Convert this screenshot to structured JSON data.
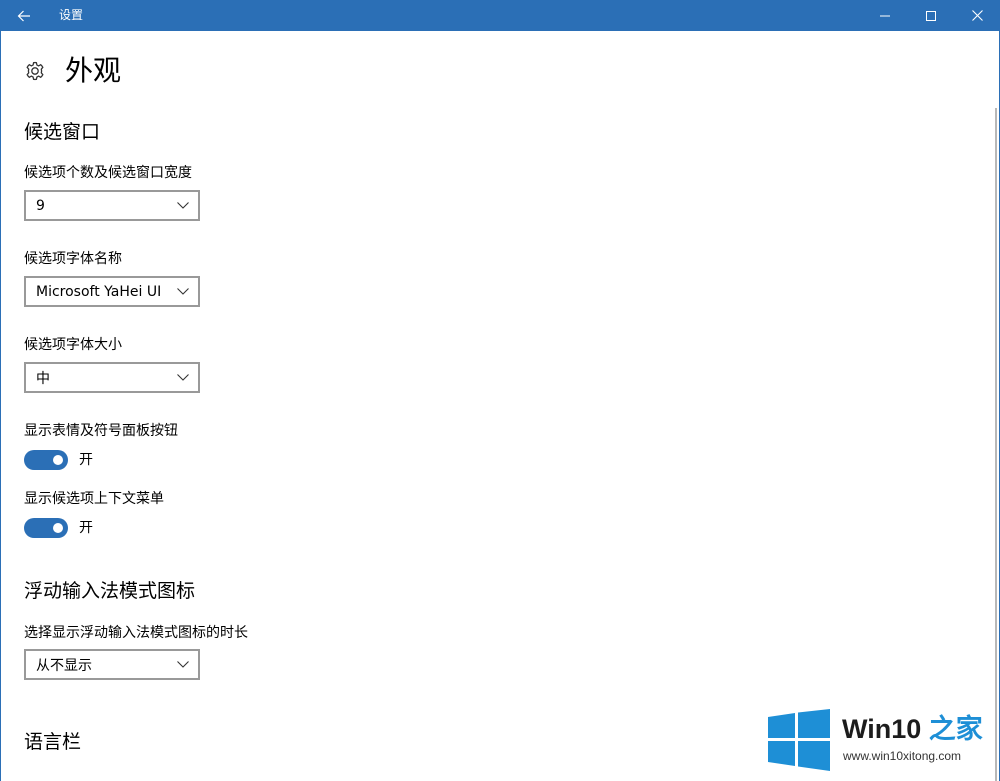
{
  "window": {
    "title": "设置",
    "back_icon": "back-arrow-icon",
    "titlebar_color": "#2b6fb6"
  },
  "page": {
    "title": "外观",
    "icon": "gear-icon"
  },
  "candidate_window": {
    "section_title": "候选窗口",
    "count_label": "候选项个数及候选窗口宽度",
    "count_value": "9",
    "font_name_label": "候选项字体名称",
    "font_name_value": "Microsoft YaHei UI",
    "font_size_label": "候选项字体大小",
    "font_size_value": "中",
    "emoji_button_label": "显示表情及符号面板按钮",
    "emoji_button_state": "开",
    "context_menu_label": "显示候选项上下文菜单",
    "context_menu_state": "开"
  },
  "floating_icon": {
    "section_title": "浮动输入法模式图标",
    "duration_label": "选择显示浮动输入法模式图标的时长",
    "duration_value": "从不显示"
  },
  "language_bar": {
    "section_title": "语言栏"
  },
  "watermark": {
    "title_main": "Win10",
    "title_accent": " 之家",
    "url": "www.win10xitong.com",
    "logo_color": "#1e8fd6"
  },
  "colors": {
    "accent": "#2b6fb6",
    "dropdown_border": "#999999"
  }
}
